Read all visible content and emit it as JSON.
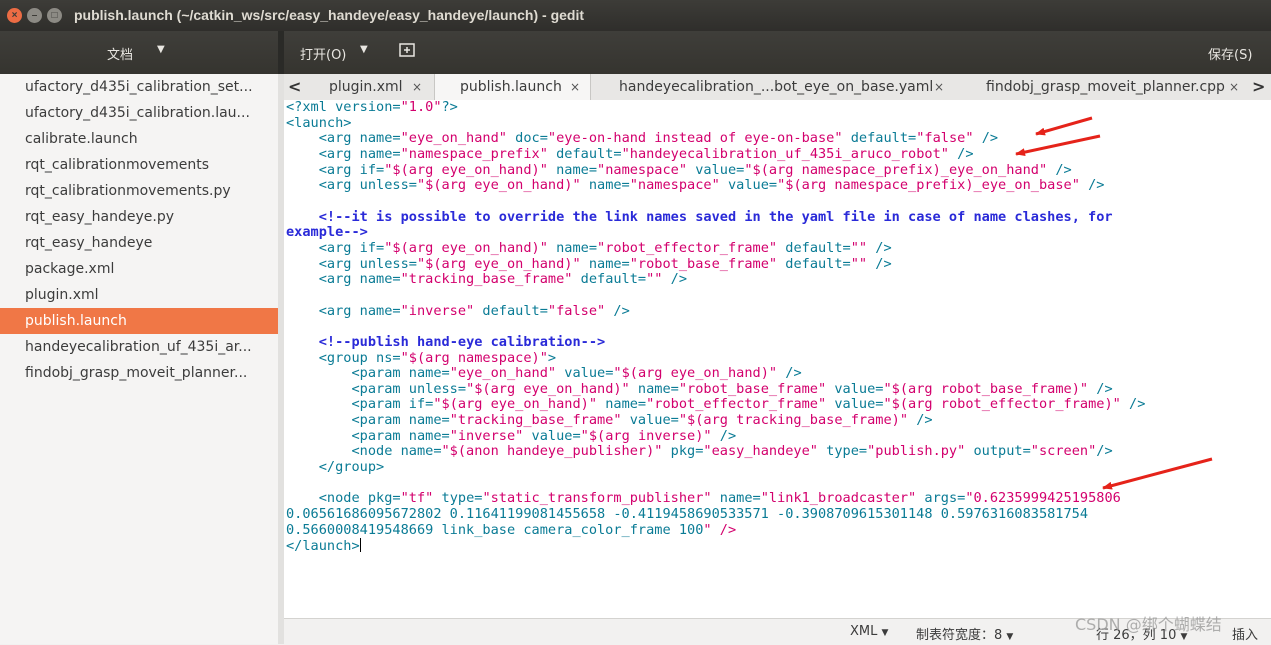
{
  "window": {
    "title": "publish.launch (~/catkin_ws/src/easy_handeye/easy_handeye/launch) - gedit",
    "close_glyph": "×",
    "min_glyph": "–",
    "max_glyph": "□"
  },
  "header": {
    "documents_label": "文档",
    "open_label": "打开(O)",
    "save_label": "保存(S)",
    "dropdown_glyph": "▼"
  },
  "sidebar": {
    "items": [
      {
        "label": "ufactory_d435i_calibration_set..."
      },
      {
        "label": "ufactory_d435i_calibration.lau..."
      },
      {
        "label": "calibrate.launch"
      },
      {
        "label": "rqt_calibrationmovements"
      },
      {
        "label": "rqt_calibrationmovements.py"
      },
      {
        "label": "rqt_easy_handeye.py"
      },
      {
        "label": "rqt_easy_handeye"
      },
      {
        "label": "package.xml"
      },
      {
        "label": "plugin.xml"
      },
      {
        "label": "publish.launch"
      },
      {
        "label": "handeyecalibration_uf_435i_ar..."
      },
      {
        "label": "findobj_grasp_moveit_planner..."
      }
    ],
    "active_index": 9
  },
  "tabs": {
    "prev_glyph": "<",
    "next_glyph": ">",
    "close_glyph": "×",
    "items": [
      {
        "label": "plugin.xml"
      },
      {
        "label": "publish.launch"
      },
      {
        "label": "handeyecalibration_...bot_eye_on_base.yaml"
      },
      {
        "label": "findobj_grasp_moveit_planner.cpp"
      }
    ],
    "active_index": 1
  },
  "editor": {
    "lines": [
      "<?xml version=\"1.0\"?>",
      "<launch>",
      "    <arg name=\"eye_on_hand\" doc=\"eye-on-hand instead of eye-on-base\" default=\"false\" />",
      "    <arg name=\"namespace_prefix\" default=\"handeyecalibration_uf_435i_aruco_robot\" />",
      "    <arg if=\"$(arg eye_on_hand)\" name=\"namespace\" value=\"$(arg namespace_prefix)_eye_on_hand\" />",
      "    <arg unless=\"$(arg eye_on_hand)\" name=\"namespace\" value=\"$(arg namespace_prefix)_eye_on_base\" />",
      "",
      "    <!--it is possible to override the link names saved in the yaml file in case of name clashes, for",
      "example-->",
      "    <arg if=\"$(arg eye_on_hand)\" name=\"robot_effector_frame\" default=\"\" />",
      "    <arg unless=\"$(arg eye_on_hand)\" name=\"robot_base_frame\" default=\"\" />",
      "    <arg name=\"tracking_base_frame\" default=\"\" />",
      "",
      "    <arg name=\"inverse\" default=\"false\" />",
      "",
      "    <!--publish hand-eye calibration-->",
      "    <group ns=\"$(arg namespace)\">",
      "        <param name=\"eye_on_hand\" value=\"$(arg eye_on_hand)\" />",
      "        <param unless=\"$(arg eye_on_hand)\" name=\"robot_base_frame\" value=\"$(arg robot_base_frame)\" />",
      "        <param if=\"$(arg eye_on_hand)\" name=\"robot_effector_frame\" value=\"$(arg robot_effector_frame)\" />",
      "        <param name=\"tracking_base_frame\" value=\"$(arg tracking_base_frame)\" />",
      "        <param name=\"inverse\" value=\"$(arg inverse)\" />",
      "        <node name=\"$(anon handeye_publisher)\" pkg=\"easy_handeye\" type=\"publish.py\" output=\"screen\"/>",
      "    </group>",
      "",
      "    <node pkg=\"tf\" type=\"static_transform_publisher\" name=\"link1_broadcaster\" args=\"0.6235999425195806",
      "0.06561686095672802 0.11641199081455658 -0.4119458690533571 -0.3908709615301148 0.5976316083581754",
      "0.5660008419548669 link_base camera_color_frame 100\" />",
      "</launch>"
    ]
  },
  "statusbar": {
    "language": "XML",
    "tab_width": "制表符宽度：8",
    "position": "行 26，列 10",
    "insert_mode": "插入",
    "dropdown_glyph": "▼"
  },
  "watermark": "CSDN @绑个蝴蝶结",
  "colors": {
    "accent": "#f07746",
    "tag": "#0a7b95",
    "value": "#d3006d",
    "comment": "#2a2ad8",
    "arrow": "#e5231a"
  }
}
